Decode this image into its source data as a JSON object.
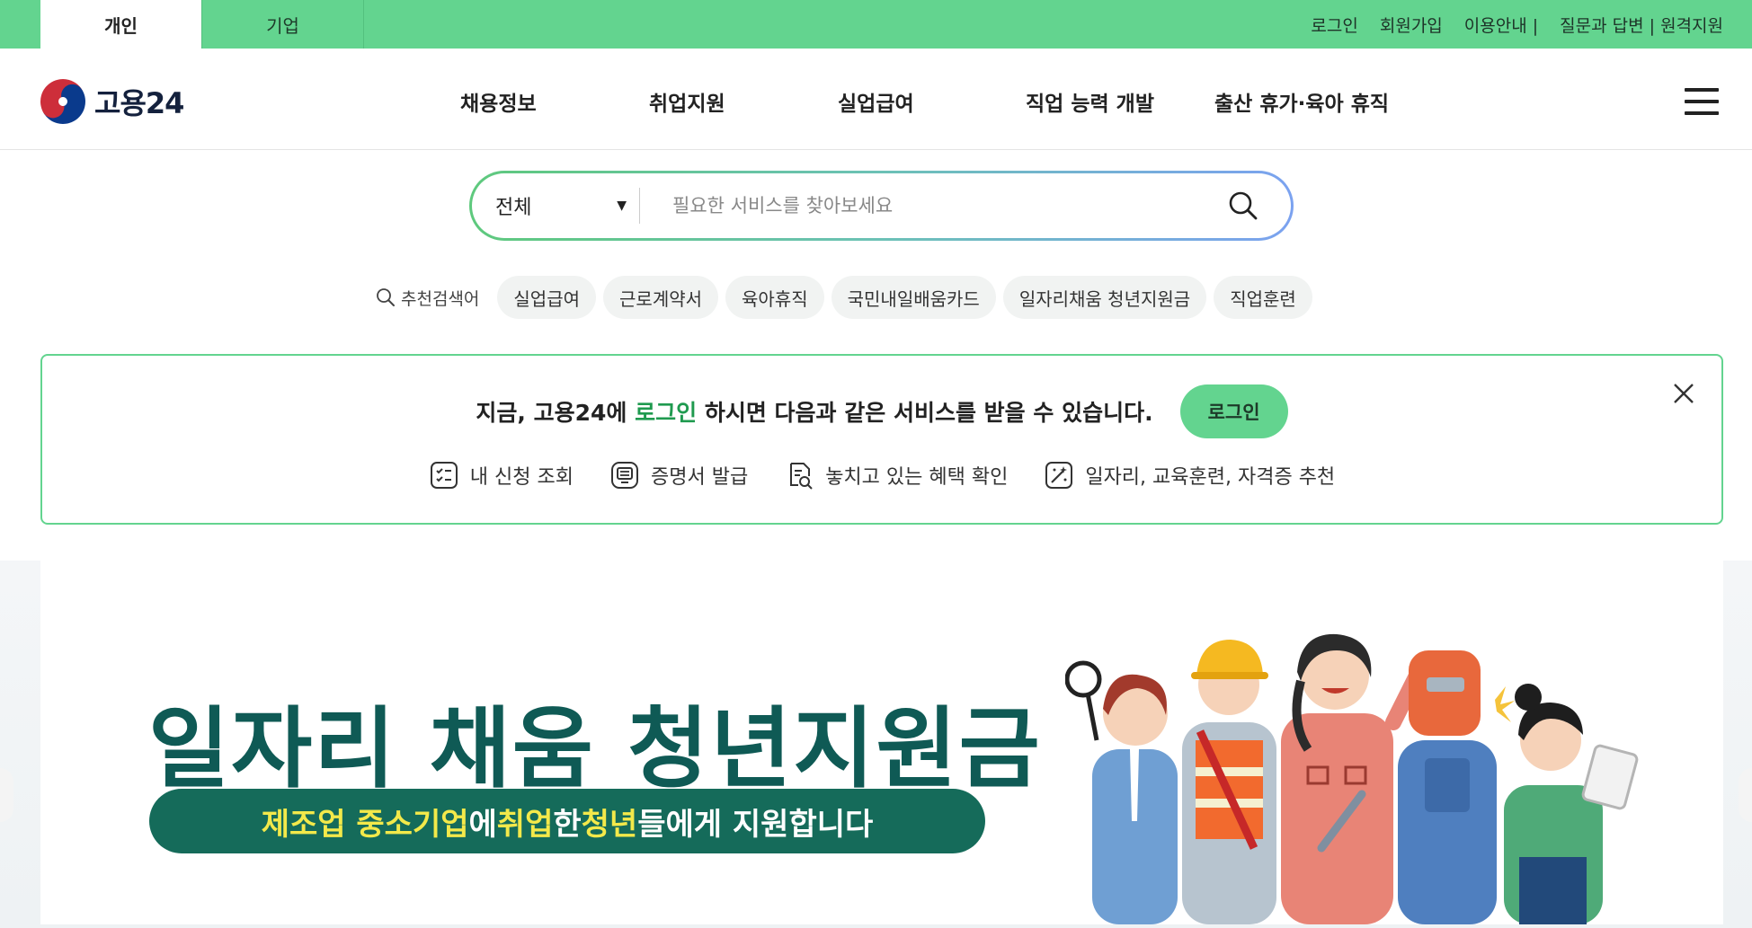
{
  "topbar": {
    "tabs": [
      {
        "label": "개인",
        "active": true
      },
      {
        "label": "기업",
        "active": false
      }
    ],
    "links": [
      "로그인",
      "회원가입",
      "이용안내 |",
      "질문과 답변 | 원격지원"
    ]
  },
  "header": {
    "logo": "고용24",
    "nav": [
      "채용정보",
      "취업지원",
      "실업급여",
      "직업 능력 개발",
      "출산 휴가·육아 휴직"
    ]
  },
  "search": {
    "category": "전체",
    "placeholder": "필요한 서비스를 찾아보세요",
    "value": ""
  },
  "keywords": {
    "lead": "추천검색어",
    "items": [
      "실업급여",
      "근로계약서",
      "육아휴직",
      "국민내일배움카드",
      "일자리채움 청년지원금",
      "직업훈련"
    ]
  },
  "notice": {
    "before": "지금, 고용24에 ",
    "highlight": "로그인",
    "after": " 하시면 다음과 같은 서비스를 받을 수 있습니다.",
    "button": "로그인",
    "services": [
      {
        "icon": "checklist-icon",
        "label": "내 신청 조회"
      },
      {
        "icon": "certificate-icon",
        "label": "증명서 발급"
      },
      {
        "icon": "benefit-search-icon",
        "label": "놓치고 있는 혜택 확인"
      },
      {
        "icon": "recommend-icon",
        "label": "일자리, 교육훈련, 자격증 추천"
      }
    ]
  },
  "banner": {
    "title": "일자리 채움 청년지원금",
    "pill": [
      "제조업 중소기업",
      "에 ",
      "취업",
      "한 ",
      "청년",
      "들에게 지원합니다"
    ]
  },
  "colors": {
    "brand_green": "#63d48f",
    "banner_teal": "#156b5a",
    "highlight_yellow": "#f3e94a"
  }
}
